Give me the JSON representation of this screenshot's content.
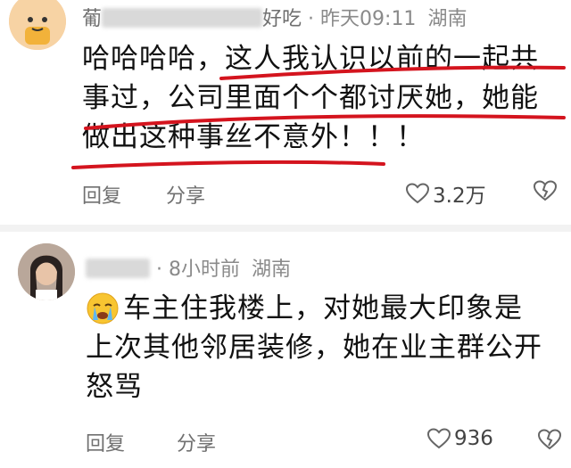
{
  "comments": [
    {
      "username_visible_start": "葡",
      "username_visible_end": "好吃",
      "time": "昨天09:11",
      "location": "湖南",
      "lines": [
        "哈哈哈哈，这人我认识以前的一起共",
        "事过，公司里面个个都讨厌她，她能",
        "做出这种事丝不意外！！！"
      ],
      "reply_label": "回复",
      "share_label": "分享",
      "likes": "3.2万"
    },
    {
      "username_visible": "",
      "time": "8小时前",
      "location": "湖南",
      "emoji": "crying-face",
      "lines": [
        "车主住我楼上，对她最大印象是",
        "上次其他邻居装修，她在业主群公开",
        "怒骂"
      ],
      "reply_label": "回复",
      "share_label": "分享",
      "likes": "936"
    }
  ],
  "colors": {
    "underline": "#d4141e",
    "text": "#111111",
    "meta": "#8a8a8a"
  },
  "icons": [
    "heart-outline-icon",
    "broken-heart-icon",
    "crying-face-emoji"
  ]
}
